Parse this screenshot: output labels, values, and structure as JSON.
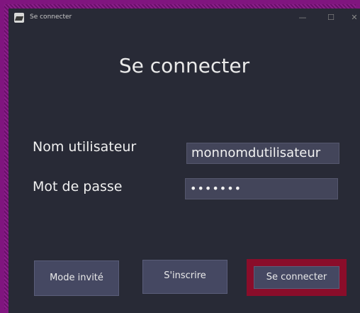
{
  "window": {
    "title": "Se connecter",
    "controls": {
      "minimize": "—",
      "maximize": "☐",
      "close": "✕"
    }
  },
  "form": {
    "heading": "Se connecter",
    "username_label": "Nom utilisateur",
    "username_value": "monnomdutilisateur",
    "password_label": "Mot de passe",
    "password_value": "•••••••"
  },
  "buttons": {
    "guest": "Mode invité",
    "register": "S'inscrire",
    "login": "Se connecter"
  },
  "colors": {
    "window_bg": "#282a36",
    "input_bg": "#43455a",
    "button_bg": "#454862",
    "login_highlight": "#8a0d2a",
    "frame_border": "#80157f"
  },
  "icons": {
    "app": "app-icon"
  }
}
